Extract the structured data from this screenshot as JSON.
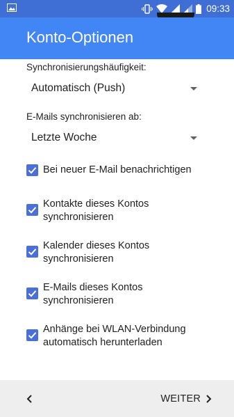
{
  "status_bar": {
    "time": "09:33",
    "icons": [
      "image-icon",
      "vibrate-icon",
      "wifi-icon",
      "signal-icon",
      "signal-icon",
      "battery-icon"
    ]
  },
  "app_bar": {
    "title": "Konto-Optionen"
  },
  "sync_frequency": {
    "label": "Synchronisierungshäufigkeit:",
    "value": "Automatisch (Push)"
  },
  "sync_since": {
    "label": "E-Mails synchronisieren ab:",
    "value": "Letzte Woche"
  },
  "options": [
    {
      "line1": "Bei neuer E-Mail benachrichtigen",
      "line2": "",
      "checked": true
    },
    {
      "line1": "Kontakte dieses Kontos",
      "line2": "synchronisieren",
      "checked": true
    },
    {
      "line1": "Kalender dieses Kontos",
      "line2": "synchronisieren",
      "checked": true
    },
    {
      "line1": "E-Mails dieses Kontos",
      "line2": "synchronisieren",
      "checked": true
    },
    {
      "line1": "Anhänge bei WLAN-Verbindung",
      "line2": "automatisch herunterladen",
      "checked": true
    }
  ],
  "bottom_bar": {
    "next_label": "WEITER"
  },
  "colors": {
    "status_bar": "#3f6fd4",
    "app_bar": "#4285f4",
    "checkbox": "#4a70d8",
    "bottom_bar": "#eeeeee"
  }
}
